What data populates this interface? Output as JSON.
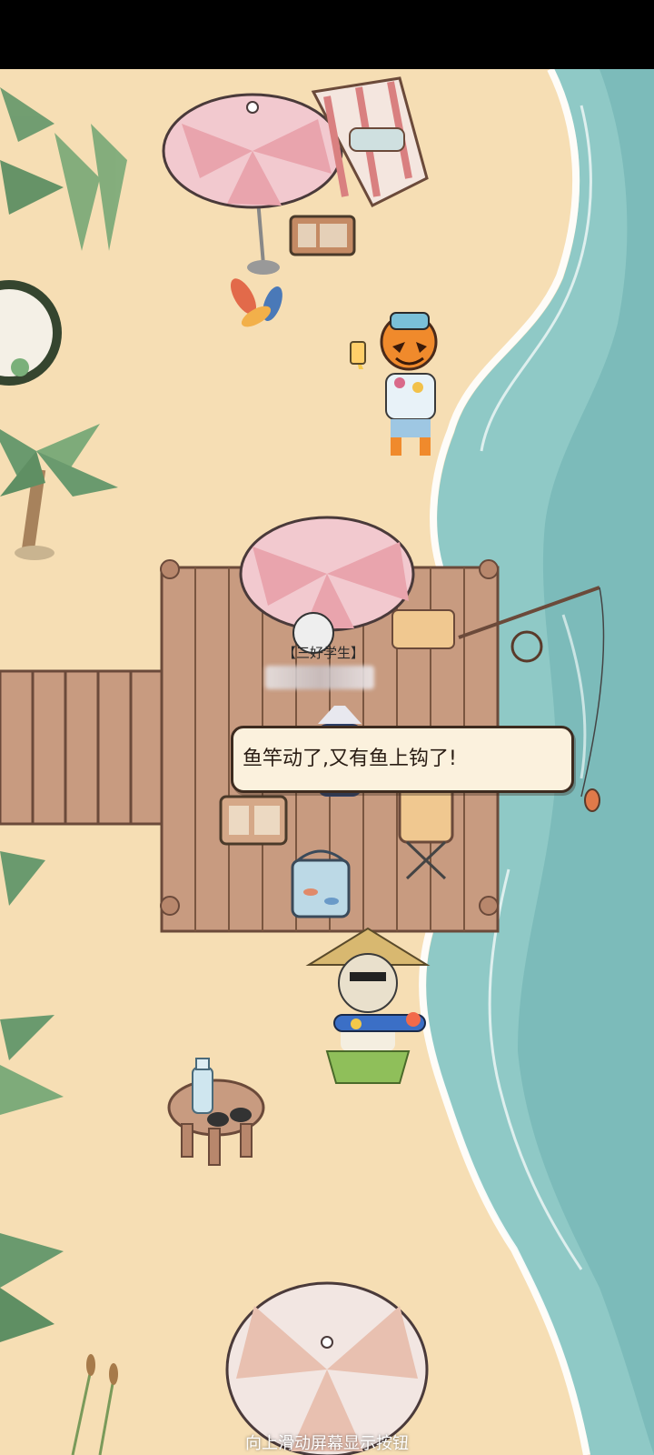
{
  "player": {
    "title": "【三好学生】"
  },
  "dialog": {
    "text": "鱼竿动了,又有鱼上钩了!"
  },
  "hint": {
    "text": "向上滑动屏幕显示按钮"
  },
  "colors": {
    "sand": "#f6deb4",
    "sea": "#8fc9c6",
    "deep_sea": "#6fb3b3",
    "foam": "#ffffff",
    "wood": "#c89b80",
    "bubble_bg": "#fbf1dd",
    "bubble_border": "#3d2b1f",
    "umbrella_pink": "#e9a4ad",
    "palm_green": "#6a9a6e"
  },
  "icons": [
    "controller-icon",
    "fishing-rod-icon"
  ]
}
